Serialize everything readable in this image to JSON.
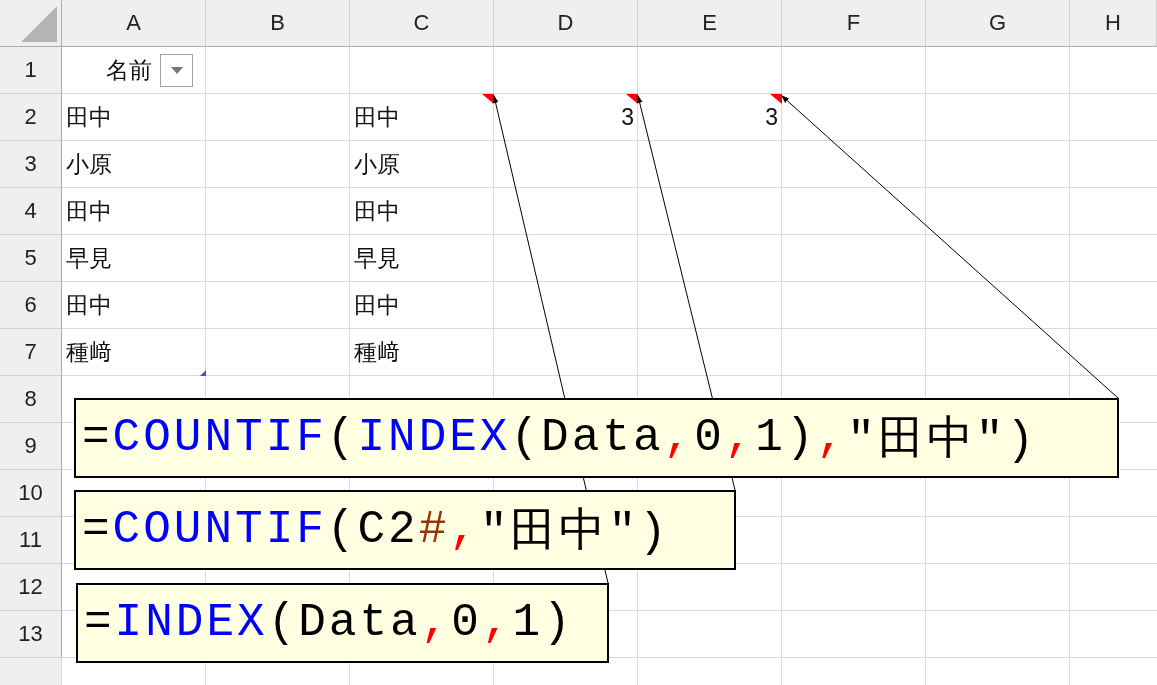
{
  "columns": [
    "A",
    "B",
    "C",
    "D",
    "E",
    "F",
    "G",
    "H"
  ],
  "rows": [
    {
      "header": "1",
      "cells": {
        "A": {
          "kind": "text",
          "text": "名前",
          "filter": true
        }
      }
    },
    {
      "header": "2",
      "cells": {
        "A": {
          "kind": "text",
          "text": "田中"
        },
        "C": {
          "kind": "text",
          "text": "田中",
          "comment": true
        },
        "D": {
          "kind": "number",
          "text": "3",
          "comment": true
        },
        "E": {
          "kind": "number",
          "text": "3",
          "comment": true
        }
      }
    },
    {
      "header": "3",
      "cells": {
        "A": {
          "kind": "text",
          "text": "小原"
        },
        "C": {
          "kind": "text",
          "text": "小原"
        }
      }
    },
    {
      "header": "4",
      "cells": {
        "A": {
          "kind": "text",
          "text": "田中"
        },
        "C": {
          "kind": "text",
          "text": "田中"
        }
      }
    },
    {
      "header": "5",
      "cells": {
        "A": {
          "kind": "text",
          "text": "早見"
        },
        "C": {
          "kind": "text",
          "text": "早見"
        }
      }
    },
    {
      "header": "6",
      "cells": {
        "A": {
          "kind": "text",
          "text": "田中"
        },
        "C": {
          "kind": "text",
          "text": "田中"
        }
      }
    },
    {
      "header": "7",
      "cells": {
        "A": {
          "kind": "text",
          "text": "種﨑",
          "table_end": true
        },
        "C": {
          "kind": "text",
          "text": "種﨑"
        }
      }
    },
    {
      "header": "8",
      "cells": {}
    },
    {
      "header": "9",
      "cells": {}
    },
    {
      "header": "10",
      "cells": {}
    },
    {
      "header": "11",
      "cells": {}
    },
    {
      "header": "12",
      "cells": {}
    },
    {
      "header": "13",
      "cells": {}
    }
  ],
  "comments": [
    {
      "tokens": [
        {
          "kind": "plain",
          "text": "="
        },
        {
          "kind": "function",
          "text": "COUNTIF"
        },
        {
          "kind": "plain",
          "text": "("
        },
        {
          "kind": "function",
          "text": "INDEX"
        },
        {
          "kind": "plain",
          "text": "(Data"
        },
        {
          "kind": "separator",
          "text": ","
        },
        {
          "kind": "plain",
          "text": "0"
        },
        {
          "kind": "separator",
          "text": ","
        },
        {
          "kind": "plain",
          "text": "1)"
        },
        {
          "kind": "separator",
          "text": ","
        },
        {
          "kind": "plain",
          "text": "\"田中\")"
        }
      ]
    },
    {
      "tokens": [
        {
          "kind": "plain",
          "text": "="
        },
        {
          "kind": "function",
          "text": "COUNTIF"
        },
        {
          "kind": "plain",
          "text": "(C2"
        },
        {
          "kind": "spill",
          "text": "#"
        },
        {
          "kind": "separator",
          "text": ","
        },
        {
          "kind": "plain",
          "text": "\"田中\")"
        }
      ]
    },
    {
      "tokens": [
        {
          "kind": "plain",
          "text": "="
        },
        {
          "kind": "function",
          "text": "INDEX"
        },
        {
          "kind": "plain",
          "text": "(Data"
        },
        {
          "kind": "separator",
          "text": ","
        },
        {
          "kind": "plain",
          "text": "0"
        },
        {
          "kind": "separator",
          "text": ","
        },
        {
          "kind": "plain",
          "text": "1)"
        }
      ]
    }
  ]
}
